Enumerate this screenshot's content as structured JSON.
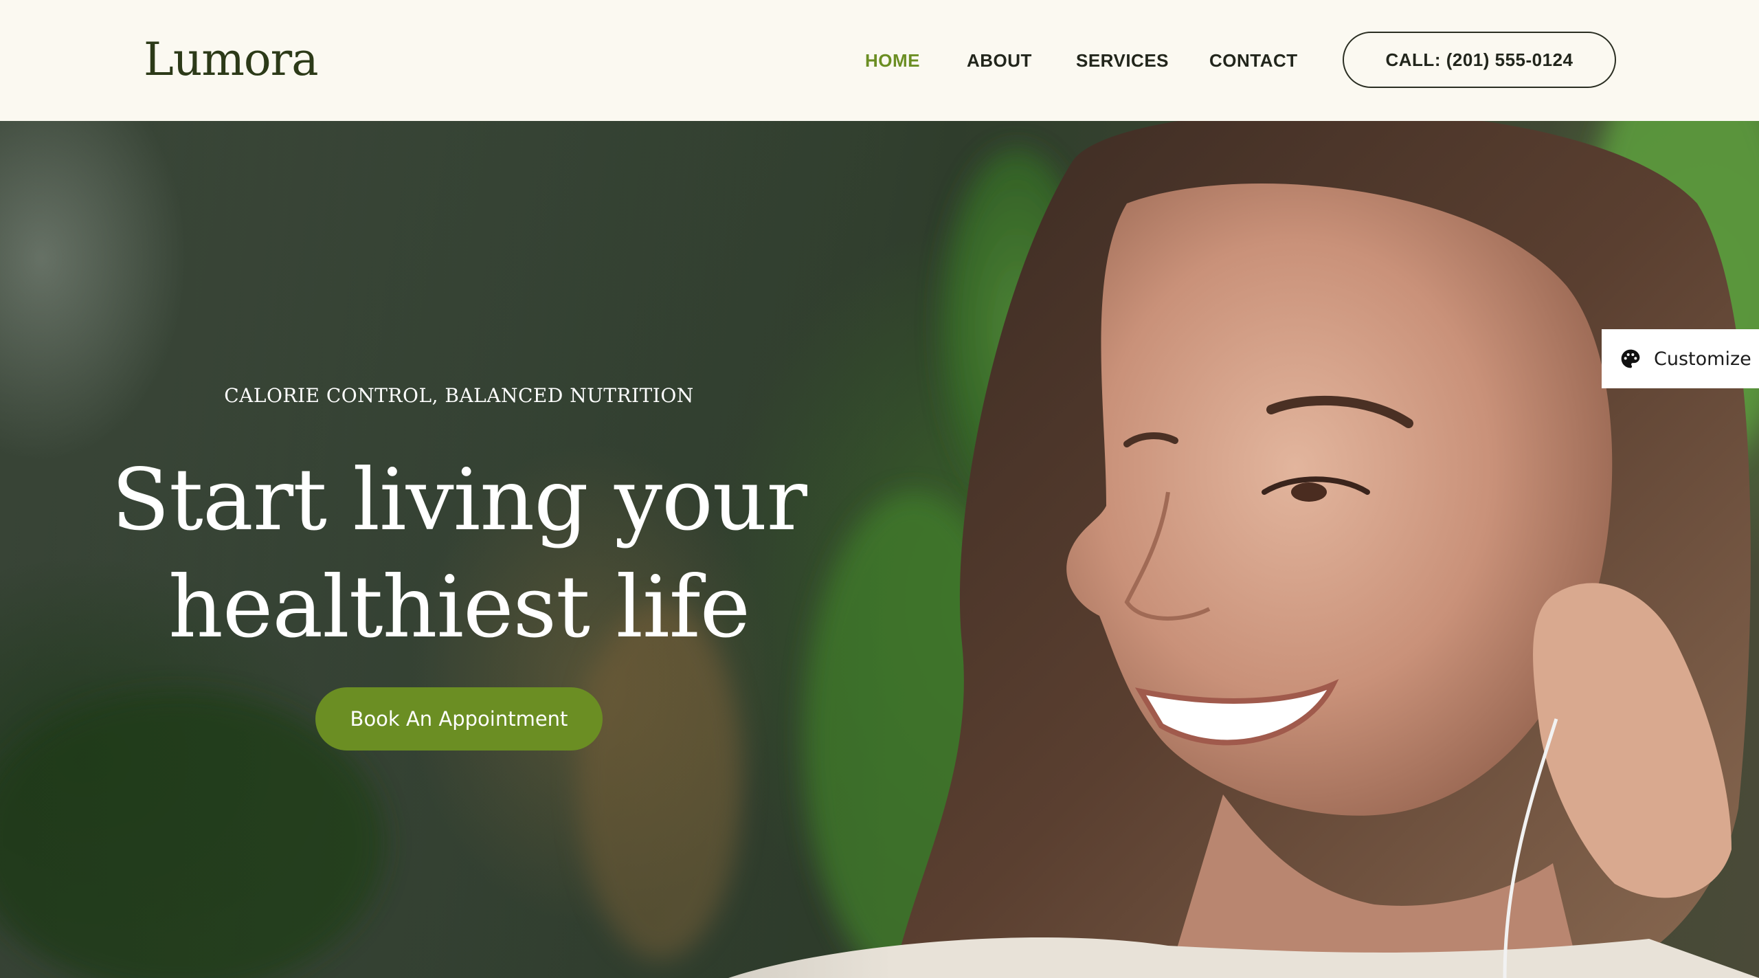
{
  "header": {
    "logo": "Lumora",
    "nav": [
      {
        "label": "HOME",
        "active": true
      },
      {
        "label": "ABOUT",
        "active": false
      },
      {
        "label": "SERVICES",
        "active": false
      },
      {
        "label": "CONTACT",
        "active": false
      }
    ],
    "call_button": "CALL: (201) 555-0124"
  },
  "hero": {
    "eyebrow": "CALORIE CONTROL, BALANCED NUTRITION",
    "headline_line1": "Start living your",
    "headline_line2": "healthiest life",
    "cta_label": "Book An Appointment",
    "image_icon": "hero-photo-icon"
  },
  "customize": {
    "label": "Customize",
    "icon": "palette-icon"
  },
  "colors": {
    "accent": "#6b8e23",
    "header_bg": "#fbf9f1",
    "text_dark": "#22261c"
  }
}
